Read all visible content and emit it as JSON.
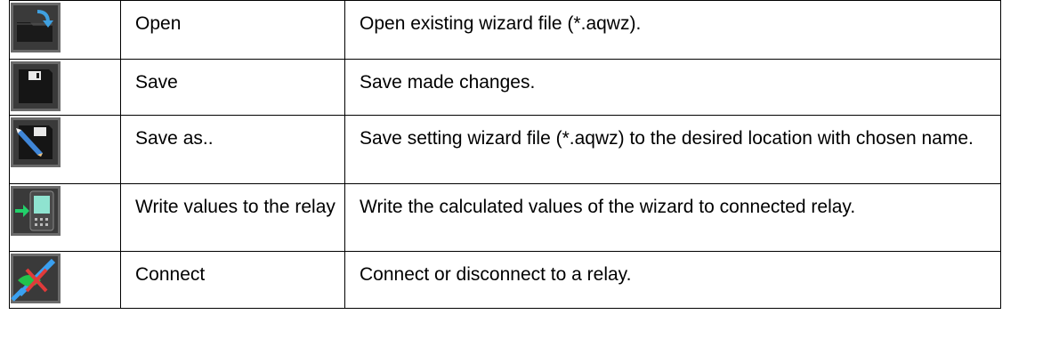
{
  "rows": [
    {
      "icon": "open-folder-icon",
      "name": "Open",
      "description": "Open existing wizard file (*.aqwz)."
    },
    {
      "icon": "floppy-disk-save-icon",
      "name": "Save",
      "description": "Save made changes."
    },
    {
      "icon": "save-as-pencil-icon",
      "name": "Save as..",
      "description": "Save setting wizard file (*.aqwz) to the desired location with chosen name."
    },
    {
      "icon": "write-to-relay-icon",
      "name": "Write values to the relay",
      "description": "Write the calculated values of the wizard to connected relay."
    },
    {
      "icon": "connect-plug-icon",
      "name": "Connect",
      "description": "Connect or disconnect to a relay."
    }
  ]
}
